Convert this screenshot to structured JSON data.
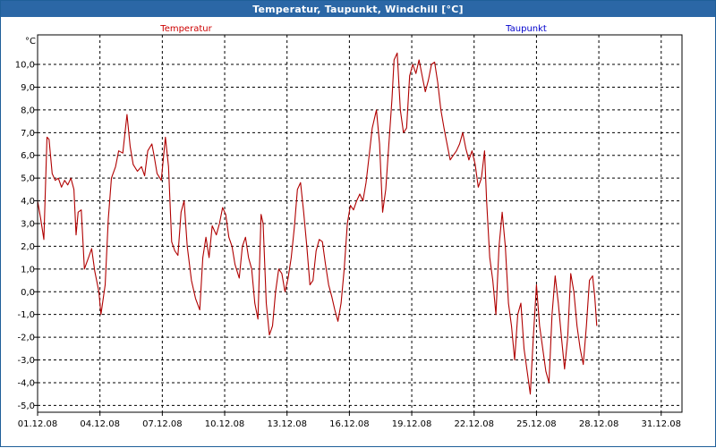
{
  "window": {
    "title": "Temperatur, Taupunkt, Windchill [°C]"
  },
  "chart_data": {
    "type": "line",
    "ylabel": "°C",
    "ylim": [
      -5.3,
      11.3
    ],
    "xlim": [
      0,
      31
    ],
    "grid": true,
    "yticks": [
      "10,0",
      "9,0",
      "8,0",
      "7,0",
      "6,0",
      "5,0",
      "4,0",
      "3,0",
      "2,0",
      "1,0",
      "0,0",
      "-1,0",
      "-2,0",
      "-3,0",
      "-4,0",
      "-5,0"
    ],
    "ytick_values": [
      10,
      9,
      8,
      7,
      6,
      5,
      4,
      3,
      2,
      1,
      0,
      -1,
      -2,
      -3,
      -4,
      -5
    ],
    "xticks": [
      "01.12.08",
      "04.12.08",
      "07.12.08",
      "10.12.08",
      "13.12.08",
      "16.12.08",
      "19.12.08",
      "22.12.08",
      "25.12.08",
      "28.12.08",
      "31.12.08"
    ],
    "xtick_values": [
      0,
      3,
      6,
      9,
      12,
      15,
      18,
      21,
      24,
      27,
      30
    ],
    "legend": [
      {
        "name": "Temperatur",
        "color": "#cc0000"
      },
      {
        "name": "Taupunkt",
        "color": "#0000cc"
      }
    ],
    "series": [
      {
        "name": "Temperatur",
        "color": "#b00000",
        "points": [
          [
            0.0,
            4.0
          ],
          [
            0.15,
            3.2
          ],
          [
            0.3,
            2.3
          ],
          [
            0.45,
            6.8
          ],
          [
            0.55,
            6.7
          ],
          [
            0.7,
            5.2
          ],
          [
            0.85,
            4.9
          ],
          [
            1.0,
            5.0
          ],
          [
            1.15,
            4.6
          ],
          [
            1.3,
            4.9
          ],
          [
            1.45,
            4.7
          ],
          [
            1.6,
            5.0
          ],
          [
            1.75,
            4.5
          ],
          [
            1.85,
            2.5
          ],
          [
            1.95,
            3.5
          ],
          [
            2.1,
            3.6
          ],
          [
            2.25,
            1.0
          ],
          [
            2.45,
            1.5
          ],
          [
            2.6,
            1.9
          ],
          [
            2.75,
            0.9
          ],
          [
            2.95,
            0.0
          ],
          [
            3.05,
            -1.0
          ],
          [
            3.25,
            0.3
          ],
          [
            3.4,
            3.2
          ],
          [
            3.55,
            5.0
          ],
          [
            3.75,
            5.5
          ],
          [
            3.9,
            6.2
          ],
          [
            4.1,
            6.1
          ],
          [
            4.3,
            7.8
          ],
          [
            4.45,
            6.4
          ],
          [
            4.6,
            5.6
          ],
          [
            4.8,
            5.3
          ],
          [
            5.0,
            5.5
          ],
          [
            5.15,
            5.1
          ],
          [
            5.3,
            6.2
          ],
          [
            5.5,
            6.5
          ],
          [
            5.6,
            6.0
          ],
          [
            5.75,
            5.2
          ],
          [
            5.95,
            4.9
          ],
          [
            6.15,
            6.8
          ],
          [
            6.3,
            5.5
          ],
          [
            6.45,
            2.2
          ],
          [
            6.6,
            1.8
          ],
          [
            6.75,
            1.6
          ],
          [
            6.9,
            3.5
          ],
          [
            7.05,
            4.0
          ],
          [
            7.2,
            2.0
          ],
          [
            7.4,
            0.5
          ],
          [
            7.6,
            -0.3
          ],
          [
            7.8,
            -0.8
          ],
          [
            7.95,
            1.5
          ],
          [
            8.1,
            2.4
          ],
          [
            8.25,
            1.5
          ],
          [
            8.4,
            2.9
          ],
          [
            8.6,
            2.5
          ],
          [
            8.75,
            3.0
          ],
          [
            8.9,
            3.7
          ],
          [
            9.05,
            3.4
          ],
          [
            9.2,
            2.4
          ],
          [
            9.35,
            2.0
          ],
          [
            9.5,
            1.2
          ],
          [
            9.7,
            0.6
          ],
          [
            9.85,
            2.0
          ],
          [
            10.0,
            2.4
          ],
          [
            10.15,
            1.5
          ],
          [
            10.3,
            1.0
          ],
          [
            10.45,
            -0.5
          ],
          [
            10.6,
            -1.2
          ],
          [
            10.75,
            3.4
          ],
          [
            10.85,
            3.0
          ],
          [
            11.0,
            -0.5
          ],
          [
            11.15,
            -1.9
          ],
          [
            11.3,
            -1.5
          ],
          [
            11.45,
            0.0
          ],
          [
            11.6,
            1.0
          ],
          [
            11.75,
            0.8
          ],
          [
            11.9,
            0.0
          ],
          [
            12.05,
            0.6
          ],
          [
            12.2,
            1.5
          ],
          [
            12.35,
            2.8
          ],
          [
            12.5,
            4.5
          ],
          [
            12.65,
            4.8
          ],
          [
            12.8,
            3.5
          ],
          [
            12.95,
            2.0
          ],
          [
            13.1,
            0.3
          ],
          [
            13.25,
            0.5
          ],
          [
            13.4,
            1.8
          ],
          [
            13.55,
            2.3
          ],
          [
            13.7,
            2.2
          ],
          [
            13.85,
            1.2
          ],
          [
            14.0,
            0.3
          ],
          [
            14.15,
            -0.2
          ],
          [
            14.3,
            -0.8
          ],
          [
            14.45,
            -1.3
          ],
          [
            14.6,
            -0.5
          ],
          [
            14.75,
            1.0
          ],
          [
            14.9,
            3.0
          ],
          [
            15.05,
            3.8
          ],
          [
            15.2,
            3.6
          ],
          [
            15.35,
            4.0
          ],
          [
            15.5,
            4.3
          ],
          [
            15.65,
            4.0
          ],
          [
            15.8,
            4.8
          ],
          [
            15.95,
            6.0
          ],
          [
            16.1,
            7.2
          ],
          [
            16.3,
            8.0
          ],
          [
            16.45,
            6.5
          ],
          [
            16.6,
            3.5
          ],
          [
            16.75,
            4.5
          ],
          [
            16.9,
            6.5
          ],
          [
            17.05,
            8.5
          ],
          [
            17.15,
            10.2
          ],
          [
            17.3,
            10.5
          ],
          [
            17.45,
            8.0
          ],
          [
            17.6,
            7.0
          ],
          [
            17.75,
            7.2
          ],
          [
            17.9,
            9.5
          ],
          [
            18.05,
            10.0
          ],
          [
            18.2,
            9.6
          ],
          [
            18.35,
            10.2
          ],
          [
            18.5,
            9.5
          ],
          [
            18.65,
            8.8
          ],
          [
            18.8,
            9.3
          ],
          [
            18.95,
            10.0
          ],
          [
            19.1,
            10.1
          ],
          [
            19.25,
            9.2
          ],
          [
            19.4,
            8.0
          ],
          [
            19.55,
            7.2
          ],
          [
            19.7,
            6.5
          ],
          [
            19.85,
            5.8
          ],
          [
            20.0,
            6.0
          ],
          [
            20.15,
            6.2
          ],
          [
            20.3,
            6.5
          ],
          [
            20.45,
            7.0
          ],
          [
            20.6,
            6.3
          ],
          [
            20.75,
            5.8
          ],
          [
            20.9,
            6.2
          ],
          [
            21.05,
            5.6
          ],
          [
            21.2,
            4.6
          ],
          [
            21.35,
            5.0
          ],
          [
            21.5,
            6.2
          ],
          [
            21.6,
            4.0
          ],
          [
            21.75,
            1.5
          ],
          [
            21.9,
            0.5
          ],
          [
            22.05,
            -1.0
          ],
          [
            22.2,
            2.0
          ],
          [
            22.35,
            3.5
          ],
          [
            22.5,
            2.0
          ],
          [
            22.65,
            -0.5
          ],
          [
            22.8,
            -1.5
          ],
          [
            22.95,
            -3.0
          ],
          [
            23.1,
            -1.0
          ],
          [
            23.25,
            -0.5
          ],
          [
            23.4,
            -2.5
          ],
          [
            23.55,
            -3.5
          ],
          [
            23.7,
            -4.5
          ],
          [
            23.85,
            -2.0
          ],
          [
            24.0,
            0.3
          ],
          [
            24.15,
            -1.5
          ],
          [
            24.3,
            -2.5
          ],
          [
            24.45,
            -3.5
          ],
          [
            24.6,
            -4.0
          ],
          [
            24.75,
            -1.0
          ],
          [
            24.9,
            0.7
          ],
          [
            25.05,
            -0.5
          ],
          [
            25.2,
            -2.0
          ],
          [
            25.35,
            -3.4
          ],
          [
            25.5,
            -2.0
          ],
          [
            25.65,
            0.8
          ],
          [
            25.8,
            0.0
          ],
          [
            25.95,
            -1.5
          ],
          [
            26.1,
            -2.5
          ],
          [
            26.25,
            -3.2
          ],
          [
            26.4,
            -1.5
          ],
          [
            26.55,
            0.5
          ],
          [
            26.7,
            0.7
          ],
          [
            26.8,
            -0.2
          ],
          [
            26.9,
            -1.5
          ]
        ]
      }
    ]
  }
}
